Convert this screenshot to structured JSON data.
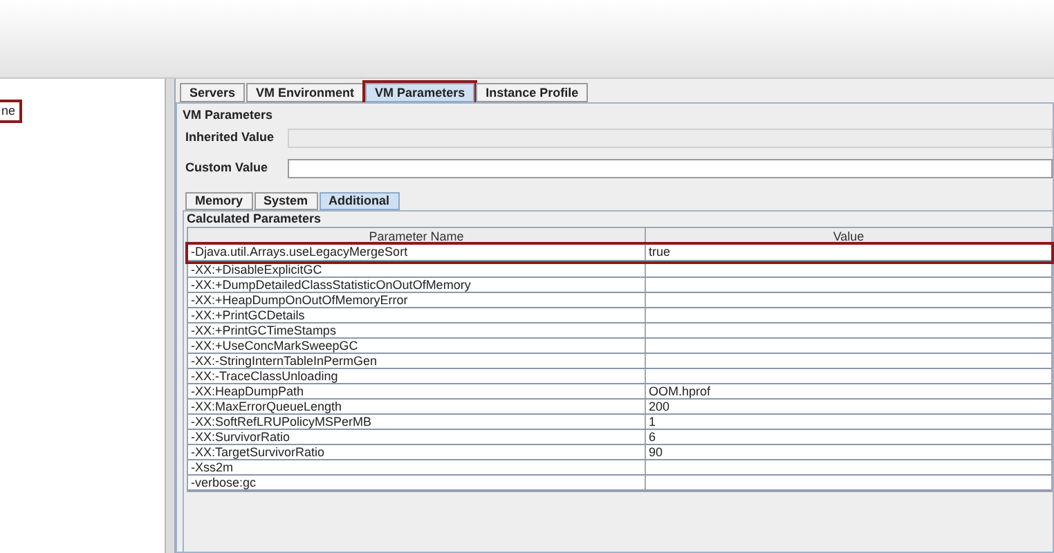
{
  "left_panel": {
    "items": [
      {
        "label": "ne",
        "highlighted": true
      }
    ]
  },
  "tabs": [
    {
      "label": "Servers",
      "selected": false,
      "highlighted": false
    },
    {
      "label": "VM Environment",
      "selected": false,
      "highlighted": false
    },
    {
      "label": "VM Parameters",
      "selected": true,
      "highlighted": true
    },
    {
      "label": "Instance Profile",
      "selected": false,
      "highlighted": false
    }
  ],
  "group_title": "VM Parameters",
  "fields": [
    {
      "label": "Inherited Value",
      "disabled": true
    },
    {
      "label": "Custom Value",
      "disabled": false
    }
  ],
  "subtabs": [
    {
      "label": "Memory",
      "selected": false
    },
    {
      "label": "System",
      "selected": false
    },
    {
      "label": "Additional",
      "selected": true
    }
  ],
  "table": {
    "title": "Calculated Parameters",
    "columns": [
      "Parameter Name",
      "Value"
    ],
    "rows": [
      {
        "name": "-Djava.util.Arrays.useLegacyMergeSort",
        "value": "true",
        "highlighted": true
      },
      {
        "name": "-XX:+DisableExplicitGC",
        "highlighted": false
      },
      {
        "name": "-XX:+DumpDetailedClassStatisticOnOutOfMemory",
        "highlighted": false
      },
      {
        "name": "-XX:+HeapDumpOnOutOfMemoryError",
        "highlighted": false
      },
      {
        "name": "-XX:+PrintGCDetails",
        "highlighted": false
      },
      {
        "name": "-XX:+PrintGCTimeStamps",
        "highlighted": false
      },
      {
        "name": "-XX:+UseConcMarkSweepGC",
        "highlighted": false
      },
      {
        "name": "-XX:-StringInternTableInPermGen",
        "highlighted": false
      },
      {
        "name": "-XX:-TraceClassUnloading",
        "highlighted": false
      },
      {
        "name": "-XX:HeapDumpPath",
        "value": "OOM.hprof",
        "highlighted": false
      },
      {
        "name": "-XX:MaxErrorQueueLength",
        "value": "200",
        "highlighted": false
      },
      {
        "name": "-XX:SoftRefLRUPolicyMSPerMB",
        "value": "1",
        "highlighted": false
      },
      {
        "name": "-XX:SurvivorRatio",
        "value": "6",
        "highlighted": false
      },
      {
        "name": "-XX:TargetSurvivorRatio",
        "value": "90",
        "highlighted": false
      },
      {
        "name": "-Xss2m",
        "highlighted": false
      },
      {
        "name": "-verbose:gc",
        "highlighted": false
      }
    ]
  }
}
